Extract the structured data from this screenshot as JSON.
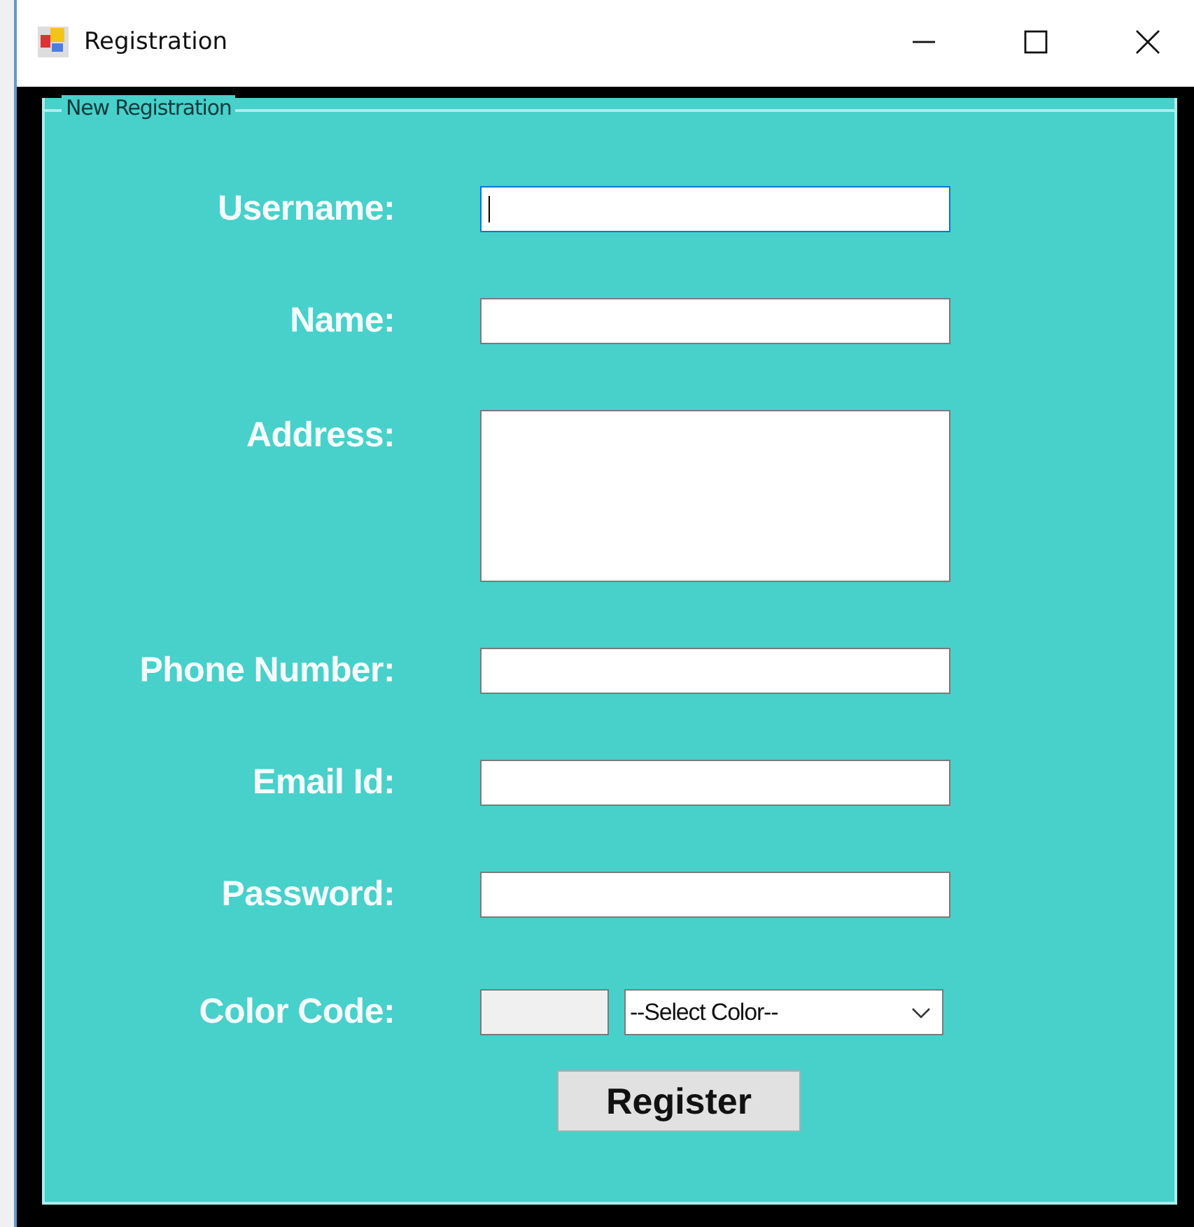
{
  "window": {
    "title": "Registration"
  },
  "group": {
    "title": "New Registration"
  },
  "fields": [
    {
      "label": "Username:",
      "kind": "text",
      "focused": true
    },
    {
      "label": "Name:",
      "kind": "text",
      "focused": false
    },
    {
      "label": "Address:",
      "kind": "textarea",
      "focused": false
    },
    {
      "label": "Phone Number:",
      "kind": "text",
      "focused": false
    },
    {
      "label": "Email Id:",
      "kind": "text",
      "focused": false
    },
    {
      "label": "Password:",
      "kind": "text",
      "focused": false
    },
    {
      "label": "Color Code:",
      "kind": "color",
      "focused": false,
      "select": "--Select Color--"
    }
  ],
  "button": "Register"
}
